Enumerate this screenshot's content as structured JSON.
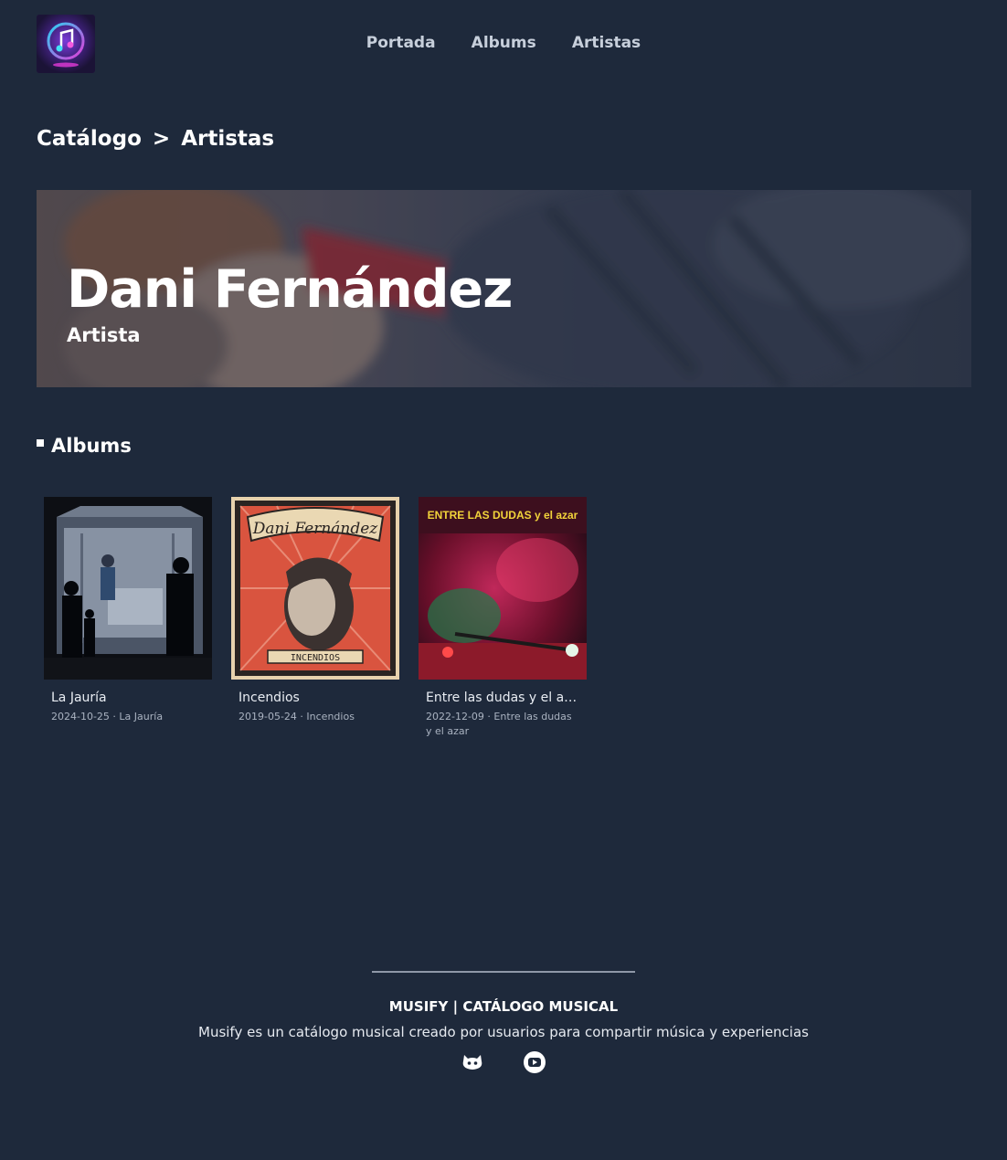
{
  "header": {
    "logo_icon": "music-note-logo-icon",
    "nav": [
      {
        "label": "Portada"
      },
      {
        "label": "Albums"
      },
      {
        "label": "Artistas"
      }
    ]
  },
  "breadcrumb": {
    "root": "Catálogo",
    "separator": ">",
    "current": "Artistas"
  },
  "artist": {
    "name": "Dani Fernández",
    "role": "Artista"
  },
  "albums_section": {
    "title": "Albums",
    "items": [
      {
        "title": "La Jauría",
        "meta": "2024-10-25 · La Jauría"
      },
      {
        "title": "Incendios",
        "meta": "2019-05-24 · Incendios",
        "cover_text": "Dani Fernández",
        "cover_subtext": "INCENDIOS"
      },
      {
        "title": "Entre las dudas y el az...",
        "meta": "2022-12-09 · Entre las dudas y el azar",
        "cover_text": "ENTRE LAS DUDAS y el azar"
      }
    ]
  },
  "footer": {
    "title": "MUSIFY | CATÁLOGO MUSICAL",
    "description": "Musify es un catálogo musical creado por usuarios para compartir música y experiencias",
    "socials": [
      {
        "icon": "github-icon"
      },
      {
        "icon": "youtube-icon"
      }
    ]
  },
  "colors": {
    "background": "#1e293b",
    "nav_text": "#c7cfdb",
    "accent_red": "#d7263d"
  }
}
